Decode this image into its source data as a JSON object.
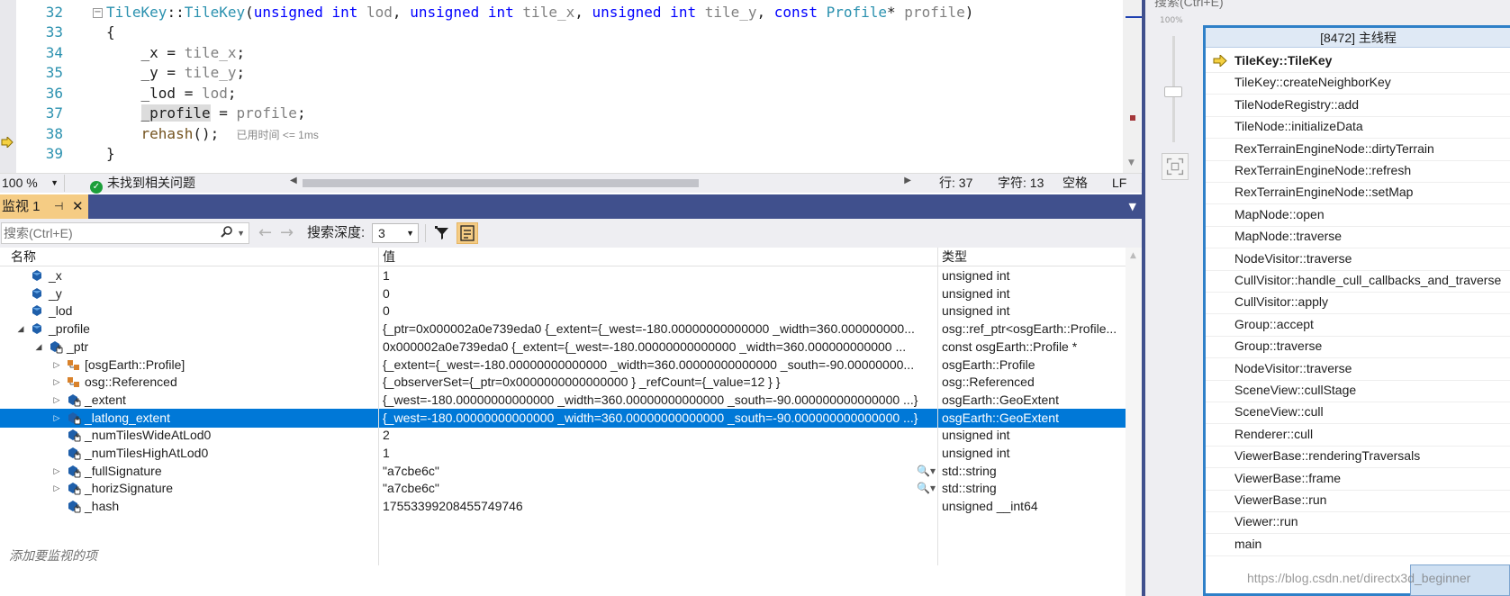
{
  "editor": {
    "line_numbers": [
      "32",
      "33",
      "34",
      "35",
      "36",
      "37",
      "38",
      "39"
    ],
    "perf_tip": "已用时间 <= 1ms",
    "status": {
      "zoom": "100 %",
      "issues": "未找到相关问题",
      "line": "行: 37",
      "col": "字符: 13",
      "whitespace": "空格",
      "eol": "LF"
    }
  },
  "watch": {
    "tab_label": "监视 1",
    "search_placeholder": "搜索(Ctrl+E)",
    "depth_label": "搜索深度:",
    "depth_value": "3",
    "columns": {
      "name": "名称",
      "value": "值",
      "type": "类型"
    },
    "rows": [
      {
        "name": "_x",
        "value": "1",
        "type": "unsigned int",
        "indent": 0,
        "expander": "",
        "icon": "field-icon",
        "selected": false,
        "inspect": false
      },
      {
        "name": "_y",
        "value": "0",
        "type": "unsigned int",
        "indent": 0,
        "expander": "",
        "icon": "field-icon",
        "selected": false,
        "inspect": false
      },
      {
        "name": "_lod",
        "value": "0",
        "type": "unsigned int",
        "indent": 0,
        "expander": "",
        "icon": "field-icon",
        "selected": false,
        "inspect": false
      },
      {
        "name": "_profile",
        "value": "{_ptr=0x000002a0e739eda0 {_extent={_west=-180.00000000000000 _width=360.000000000...",
        "type": "osg::ref_ptr<osgEarth::Profile...",
        "indent": 0,
        "expander": "◢",
        "icon": "field-icon",
        "selected": false,
        "inspect": false
      },
      {
        "name": "_ptr",
        "value": "0x000002a0e739eda0 {_extent={_west=-180.00000000000000 _width=360.000000000000 ...",
        "type": "const osgEarth::Profile *",
        "indent": 1,
        "expander": "◢",
        "icon": "private-field-icon",
        "selected": false,
        "inspect": false
      },
      {
        "name": "[osgEarth::Profile]",
        "value": "{_extent={_west=-180.00000000000000 _width=360.00000000000000 _south=-90.00000000...",
        "type": "osgEarth::Profile",
        "indent": 2,
        "expander": "▷",
        "icon": "base-class-icon",
        "selected": false,
        "inspect": false
      },
      {
        "name": "osg::Referenced",
        "value": "{_observerSet={_ptr=0x0000000000000000 } _refCount={_value=12 } }",
        "type": "osg::Referenced",
        "indent": 2,
        "expander": "▷",
        "icon": "base-class-icon",
        "selected": false,
        "inspect": false
      },
      {
        "name": "_extent",
        "value": "{_west=-180.00000000000000 _width=360.00000000000000 _south=-90.000000000000000 ...}",
        "type": "osgEarth::GeoExtent",
        "indent": 2,
        "expander": "▷",
        "icon": "private-field-icon",
        "selected": false,
        "inspect": false
      },
      {
        "name": "_latlong_extent",
        "value": "{_west=-180.00000000000000 _width=360.00000000000000 _south=-90.000000000000000 ...}",
        "type": "osgEarth::GeoExtent",
        "indent": 2,
        "expander": "▷",
        "icon": "private-field-icon",
        "selected": true,
        "inspect": false
      },
      {
        "name": "_numTilesWideAtLod0",
        "value": "2",
        "type": "unsigned int",
        "indent": 2,
        "expander": "",
        "icon": "private-field-icon",
        "selected": false,
        "inspect": false
      },
      {
        "name": "_numTilesHighAtLod0",
        "value": "1",
        "type": "unsigned int",
        "indent": 2,
        "expander": "",
        "icon": "private-field-icon",
        "selected": false,
        "inspect": false
      },
      {
        "name": "_fullSignature",
        "value": "\"a7cbe6c\"",
        "type": "std::string",
        "indent": 2,
        "expander": "▷",
        "icon": "private-field-icon",
        "selected": false,
        "inspect": true
      },
      {
        "name": "_horizSignature",
        "value": "\"a7cbe6c\"",
        "type": "std::string",
        "indent": 2,
        "expander": "▷",
        "icon": "private-field-icon",
        "selected": false,
        "inspect": true
      },
      {
        "name": "_hash",
        "value": "17553399208455749746",
        "type": "unsigned __int64",
        "indent": 2,
        "expander": "",
        "icon": "private-field-icon",
        "selected": false,
        "inspect": false
      }
    ],
    "add_watch_hint": "添加要监视的项"
  },
  "callstack": {
    "search_hint": "搜索(Ctrl+E)",
    "zoom_pct": "100%",
    "thread": "[8472] 主线程",
    "frames": [
      "TileKey::TileKey",
      "TileKey::createNeighborKey",
      "TileNodeRegistry::add",
      "TileNode::initializeData",
      "RexTerrainEngineNode::dirtyTerrain",
      "RexTerrainEngineNode::refresh",
      "RexTerrainEngineNode::setMap",
      "MapNode::open",
      "MapNode::traverse",
      "NodeVisitor::traverse",
      "CullVisitor::handle_cull_callbacks_and_traverse",
      "CullVisitor::apply",
      "Group::accept",
      "Group::traverse",
      "NodeVisitor::traverse",
      "SceneView::cullStage",
      "SceneView::cull",
      "Renderer::cull",
      "ViewerBase::renderingTraversals",
      "ViewerBase::frame",
      "ViewerBase::run",
      "Viewer::run",
      "main"
    ]
  },
  "watermark": "https://blog.csdn.net/directx3d_beginner",
  "colors": {
    "accent": "#40508d",
    "selection": "#0078d7",
    "tab_active": "#f5cc84",
    "type_color": "#2b91af",
    "keyword_color": "#0000ff"
  }
}
